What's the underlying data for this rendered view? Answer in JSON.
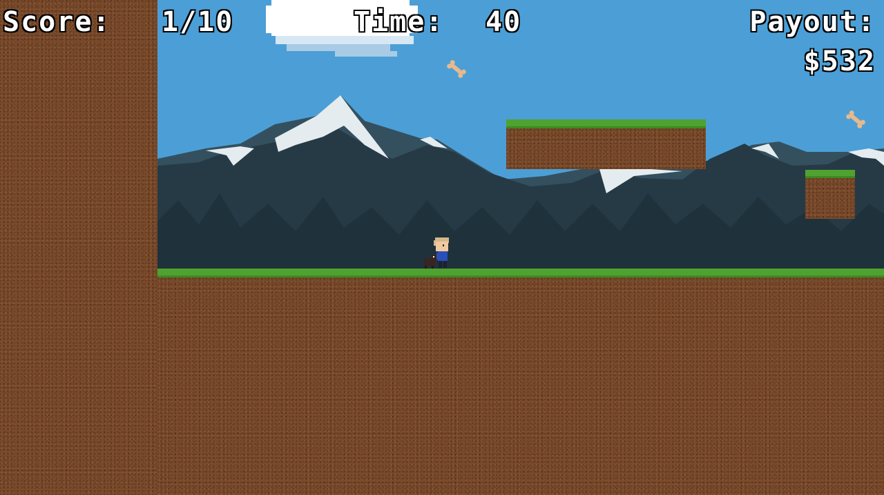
{
  "hud": {
    "score_label": "Score:",
    "score_value": "1/10",
    "time_label": "Time:",
    "time_value": "40",
    "payout_label": "Payout:",
    "payout_value": "$532"
  },
  "colors": {
    "sky": "#4b9fd6",
    "dirt": "#7b4a2a",
    "grass": "#4fa22f",
    "mountain_dark": "#263a46",
    "mountain_mid": "#34505f",
    "snow": "#e4ecef"
  },
  "scene": {
    "player": "boy-in-blue-shirt",
    "companion": "small-dark-dog",
    "collectibles": [
      "bone-icon",
      "bone-icon"
    ],
    "platforms": [
      "floating-grass-platform-large",
      "floating-grass-platform-small"
    ]
  }
}
